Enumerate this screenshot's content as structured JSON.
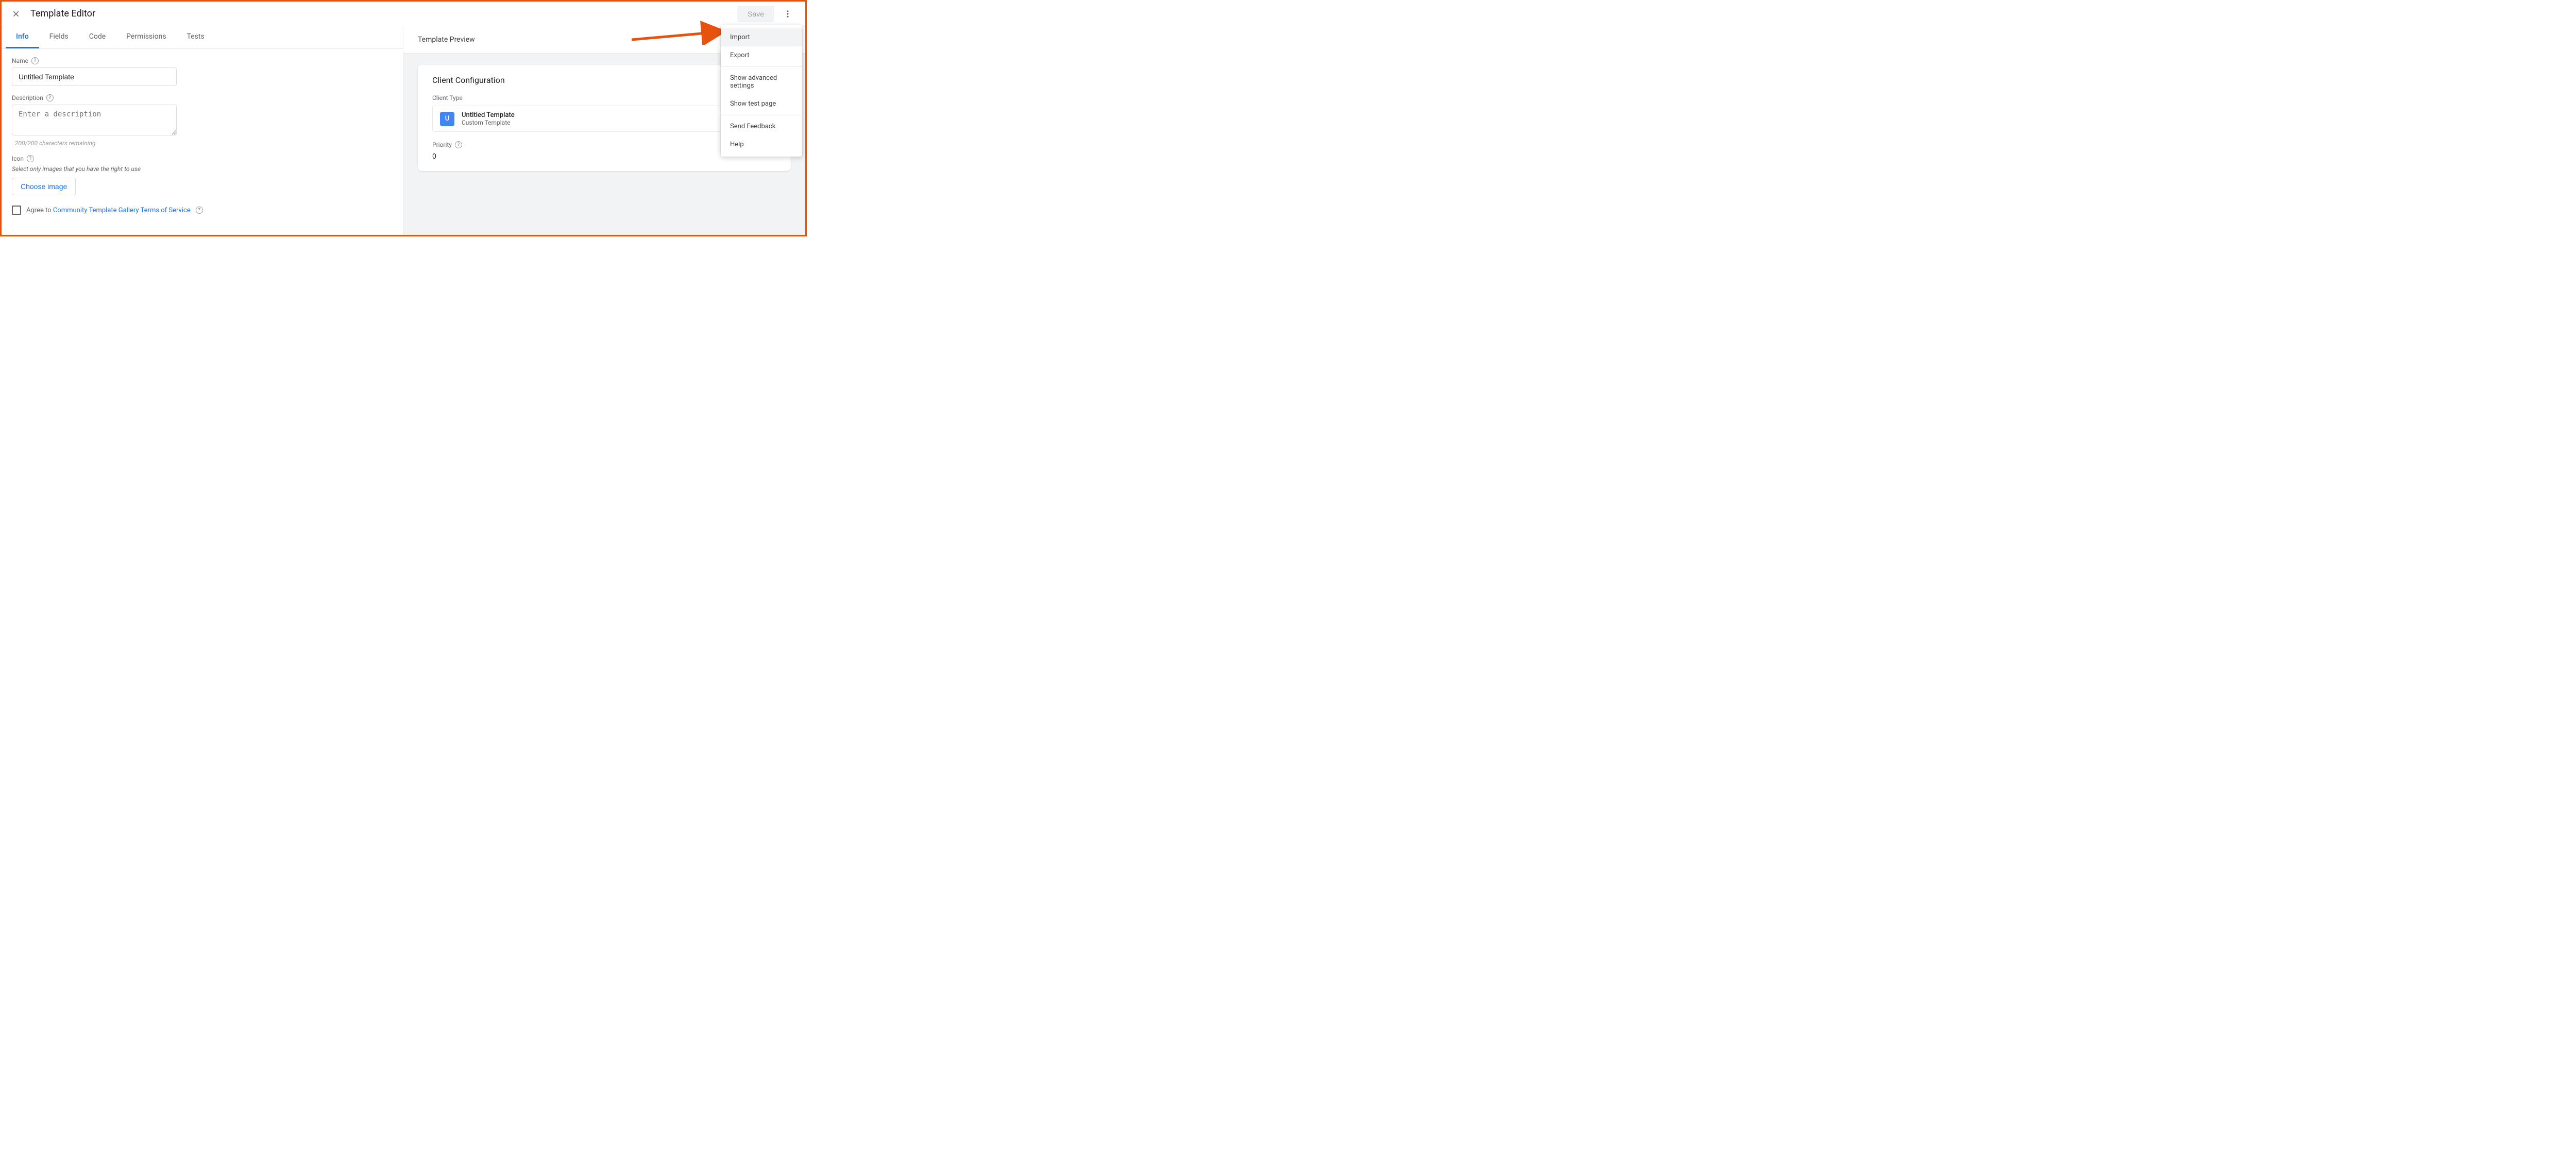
{
  "header": {
    "title": "Template Editor",
    "save_label": "Save"
  },
  "tabs": [
    "Info",
    "Fields",
    "Code",
    "Permissions",
    "Tests"
  ],
  "form": {
    "name_label": "Name",
    "name_value": "Untitled Template",
    "desc_label": "Description",
    "desc_placeholder": "Enter a description",
    "desc_counter": "200/200 characters remaining",
    "icon_label": "Icon",
    "icon_hint": "Select only images that you have the right to use",
    "choose_image": "Choose image",
    "agree_prefix": "Agree to ",
    "agree_link": "Community Template Gallery Terms of Service"
  },
  "preview": {
    "title": "Template Preview",
    "card_title": "Client Configuration",
    "client_type_label": "Client Type",
    "client_icon_letter": "U",
    "client_name": "Untitled Template",
    "client_sub": "Custom Template",
    "priority_label": "Priority",
    "priority_value": "0"
  },
  "menu": {
    "import": "Import",
    "export": "Export",
    "advanced": "Show advanced settings",
    "testpage": "Show test page",
    "feedback": "Send Feedback",
    "help": "Help"
  }
}
